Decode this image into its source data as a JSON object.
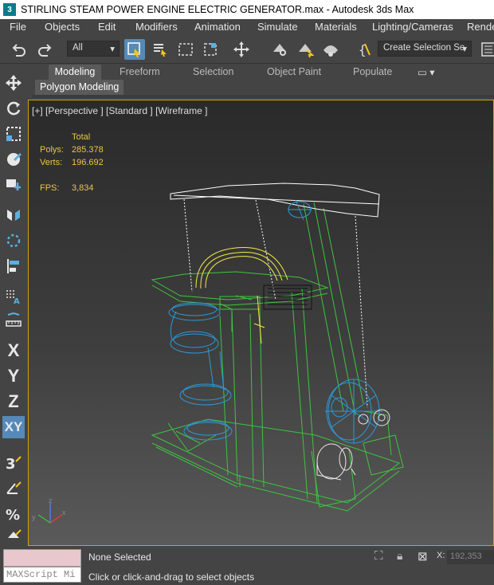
{
  "window": {
    "title": "STIRLING STEAM POWER ENGINE ELECTRIC GENERATOR.max - Autodesk 3ds Max",
    "icon_text": "3"
  },
  "menu": [
    "File",
    "Objects",
    "Edit",
    "Modifiers",
    "Animation",
    "Simulate",
    "Materials",
    "Lighting/Cameras",
    "Rende"
  ],
  "toolbar": {
    "filter_value": "All",
    "selection_set_value": "Create Selection Se"
  },
  "ribbon": {
    "tabs": [
      "Modeling",
      "Freeform",
      "Selection",
      "Object Paint",
      "Populate"
    ],
    "active_tab": "Modeling",
    "panel": "Polygon Modeling"
  },
  "left_tools": {
    "axis_x": "X",
    "axis_y": "Y",
    "axis_z": "Z",
    "axis_xy": "XY"
  },
  "viewport": {
    "label": "[+] [Perspective ] [Standard ] [Wireframe ]",
    "stats_header": "Total",
    "polys_label": "Polys:",
    "polys_value": "285.378",
    "verts_label": "Verts:",
    "verts_value": "196.692",
    "fps_label": "FPS:",
    "fps_value": "3,834",
    "axis_labels": [
      "z",
      "x",
      "y"
    ]
  },
  "status": {
    "maxscript_placeholder": "MAXScript Mi",
    "selection": "None Selected",
    "hint": "Click or click-and-drag to select objects",
    "x_label": "X:",
    "x_value": "192,353"
  },
  "colors": {
    "frame": "#3fc43f",
    "rings": "#2a9ad8",
    "pipe": "#f5e84a",
    "beam": "#ffffff",
    "viewport_border": "#c9a800"
  }
}
